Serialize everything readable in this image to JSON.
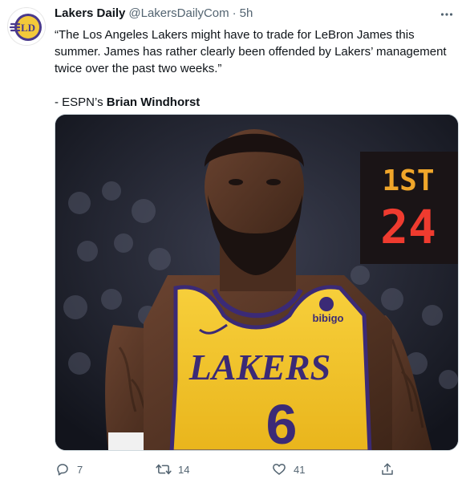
{
  "tweet": {
    "author": {
      "display_name": "Lakers Daily",
      "handle": "@LakersDailyCom",
      "separator": "·",
      "time": "5h"
    },
    "quote_line": "“The Los Angeles Lakers might have to trade for LeBron James this summer. James has rather clearly been offended by Lakers’ management twice over the past two weeks.”",
    "attribution_prefix": "- ESPN’s ",
    "attribution_name": "Brian Windhorst",
    "image": {
      "jersey_text": "LAKERS",
      "jersey_number": "6",
      "sponsor": "bibigo",
      "scoreboard_label": "1ST",
      "scoreboard_value": "24"
    },
    "actions": {
      "replies": "7",
      "retweets": "14",
      "likes": "41"
    }
  },
  "icons": {
    "more": "more-horizontal-icon",
    "reply": "reply-icon",
    "retweet": "retweet-icon",
    "like": "heart-icon",
    "share": "share-icon"
  },
  "colors": {
    "text_primary": "#0f1419",
    "text_secondary": "#536471",
    "lakers_gold": "#f5c425",
    "lakers_purple": "#3b2a76"
  }
}
